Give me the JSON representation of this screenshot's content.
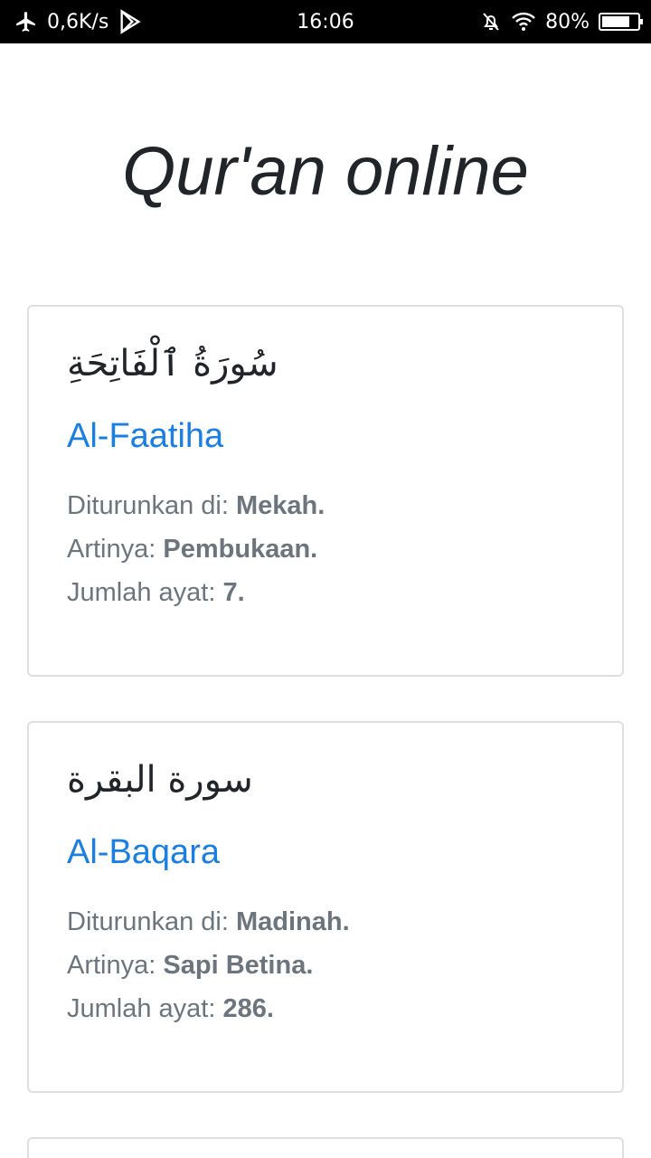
{
  "status_bar": {
    "net_speed": "0,6K/s",
    "time": "16:06",
    "battery_text": "80%",
    "battery_level": 0.8,
    "icons": [
      "airplane-icon",
      "play-store-icon",
      "mute-icon",
      "wifi-icon",
      "battery-icon"
    ]
  },
  "page": {
    "title": "Qur'an online"
  },
  "labels": {
    "revealed": "Diturunkan di:",
    "meaning": "Artinya:",
    "verses": "Jumlah ayat:"
  },
  "surahs": [
    {
      "arabic": "سُورَةُ ٱلْفَاتِحَةِ",
      "name": "Al-Faatiha",
      "revealed": "Mekah.",
      "meaning": "Pembukaan.",
      "verses": "7."
    },
    {
      "arabic": "سورة البقرة",
      "name": "Al-Baqara",
      "revealed": "Madinah.",
      "meaning": "Sapi Betina.",
      "verses": "286."
    }
  ],
  "colors": {
    "link": "#1a7fe0",
    "muted_text": "#6c757d",
    "title_text": "#212529",
    "card_border": "#dfdfdf"
  }
}
